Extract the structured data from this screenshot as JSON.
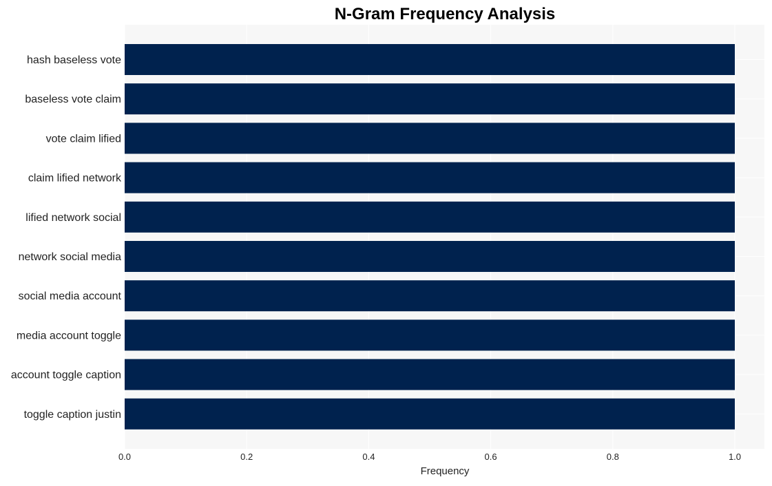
{
  "chart_data": {
    "type": "bar",
    "orientation": "horizontal",
    "title": "N-Gram Frequency Analysis",
    "xlabel": "Frequency",
    "ylabel": "",
    "categories": [
      "hash baseless vote",
      "baseless vote claim",
      "vote claim lified",
      "claim lified network",
      "lified network social",
      "network social media",
      "social media account",
      "media account toggle",
      "account toggle caption",
      "toggle caption justin"
    ],
    "values": [
      1,
      1,
      1,
      1,
      1,
      1,
      1,
      1,
      1,
      1
    ],
    "xlim": [
      0,
      1.05
    ],
    "xticks": [
      0.0,
      0.2,
      0.4,
      0.6,
      0.8,
      1.0
    ],
    "xtick_labels": [
      "0.0",
      "0.2",
      "0.4",
      "0.6",
      "0.8",
      "1.0"
    ],
    "grid": true,
    "legend": "none",
    "colors": {
      "bar": "#00224e",
      "plot_background": "#f7f7f7",
      "grid": "#ffffff",
      "text": "#222222",
      "title": "#000000"
    }
  }
}
